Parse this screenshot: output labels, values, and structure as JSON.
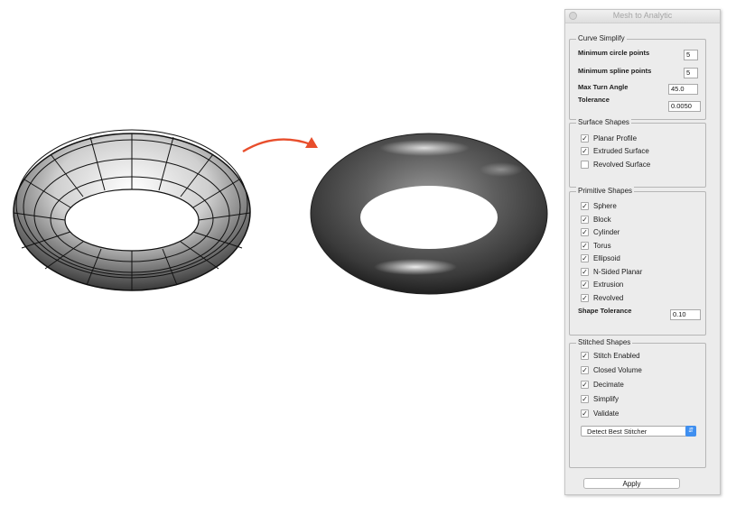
{
  "window": {
    "title": "Mesh to Analytic"
  },
  "colors": {
    "arrow": "#e84e2c",
    "accent": "#3f8ff0"
  },
  "curve_simplify": {
    "title": "Curve Simplify",
    "min_circle_points": {
      "label": "Minimum circle points",
      "value": "5"
    },
    "min_spline_points": {
      "label": "Minimum spline points",
      "value": "5"
    },
    "max_turn_angle": {
      "label": "Max Turn Angle",
      "value": "45.0"
    },
    "tolerance": {
      "label": "Tolerance",
      "value": "0.0050"
    }
  },
  "surface_shapes": {
    "title": "Surface Shapes",
    "items": [
      {
        "label": "Planar Profile",
        "checked": true
      },
      {
        "label": "Extruded Surface",
        "checked": true
      },
      {
        "label": "Revolved Surface",
        "checked": false
      }
    ]
  },
  "primitive_shapes": {
    "title": "Primitive Shapes",
    "items": [
      {
        "label": "Sphere",
        "checked": true
      },
      {
        "label": "Block",
        "checked": true
      },
      {
        "label": "Cylinder",
        "checked": true
      },
      {
        "label": "Torus",
        "checked": true
      },
      {
        "label": "Ellipsoid",
        "checked": true
      },
      {
        "label": "N-Sided Planar",
        "checked": true
      },
      {
        "label": "Extrusion",
        "checked": true
      },
      {
        "label": "Revolved",
        "checked": true
      }
    ],
    "shape_tolerance": {
      "label": "Shape Tolerance",
      "value": "0.10"
    }
  },
  "stitched_shapes": {
    "title": "Stitched Shapes",
    "items": [
      {
        "label": "Stitch Enabled",
        "checked": true
      },
      {
        "label": "Closed Volume",
        "checked": true
      },
      {
        "label": "Decimate",
        "checked": true
      },
      {
        "label": "Simplify",
        "checked": true
      },
      {
        "label": "Validate",
        "checked": true
      }
    ],
    "stitcher": {
      "selected": "Detect Best Stitcher"
    }
  },
  "apply_label": "Apply"
}
